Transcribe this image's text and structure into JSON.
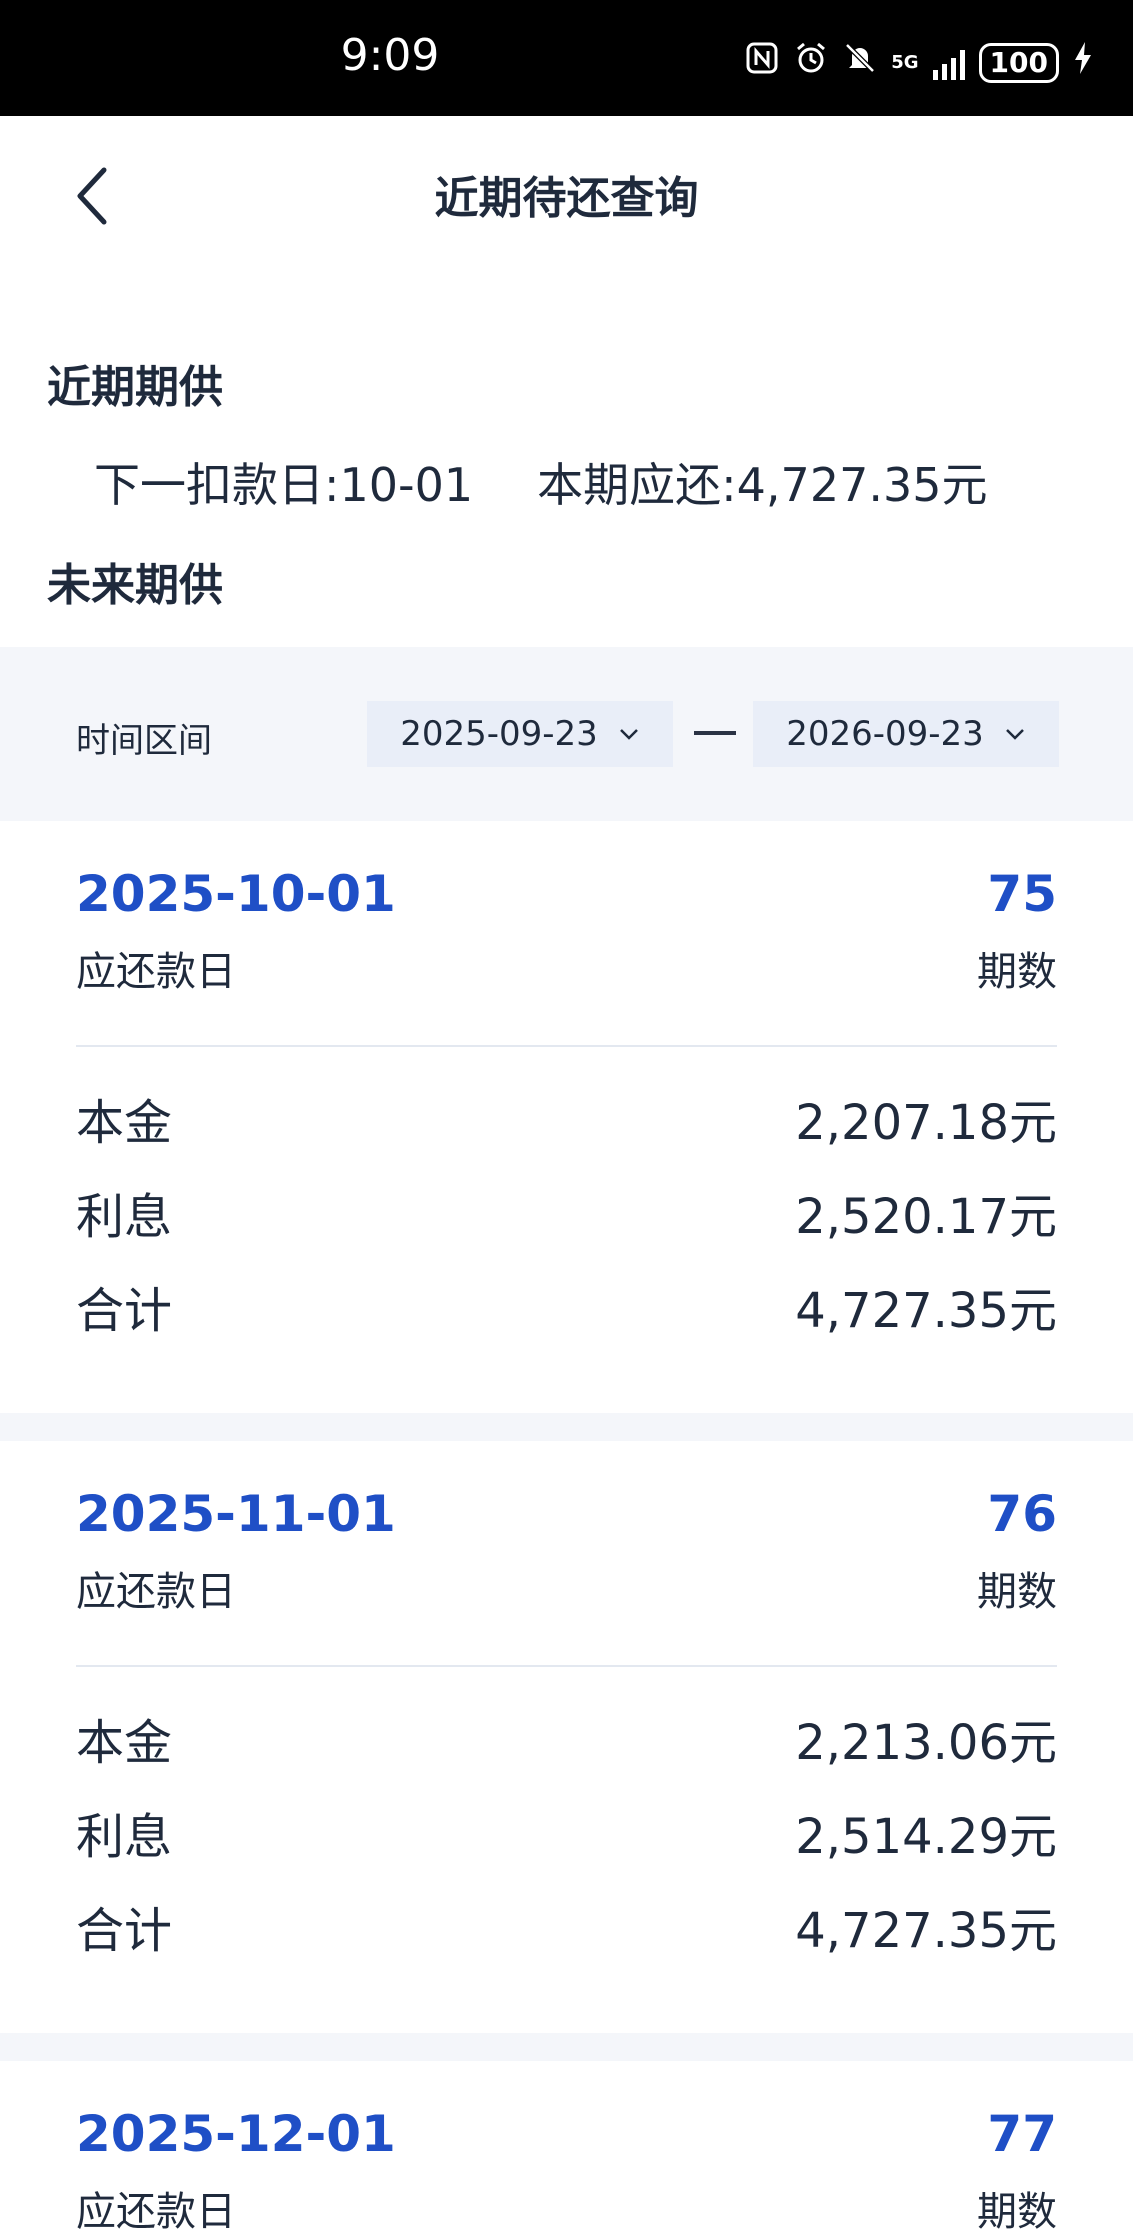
{
  "status_bar": {
    "time": "9:09",
    "battery": "100",
    "network": "5G",
    "icons": [
      "nfc-icon",
      "alarm-icon",
      "mute-icon",
      "signal-icon",
      "battery-icon",
      "charging-icon"
    ]
  },
  "header": {
    "title": "近期待还查询",
    "back_icon": "chevron-left-icon"
  },
  "recent": {
    "section_title": "近期期供",
    "next_deduction": "下一扣款日:10-01",
    "current_due": "本期应还:4,727.35元"
  },
  "future": {
    "section_title": "未来期供",
    "filter": {
      "label": "时间区间",
      "start_date": "2025-09-23",
      "end_date": "2026-09-23"
    }
  },
  "installments": [
    {
      "due_date": "2025-10-01",
      "due_date_label": "应还款日",
      "period": "75",
      "period_label": "期数",
      "rows": [
        {
          "label": "本金",
          "value": "2,207.18元"
        },
        {
          "label": "利息",
          "value": "2,520.17元"
        },
        {
          "label": "合计",
          "value": "4,727.35元"
        }
      ]
    },
    {
      "due_date": "2025-11-01",
      "due_date_label": "应还款日",
      "period": "76",
      "period_label": "期数",
      "rows": [
        {
          "label": "本金",
          "value": "2,213.06元"
        },
        {
          "label": "利息",
          "value": "2,514.29元"
        },
        {
          "label": "合计",
          "value": "4,727.35元"
        }
      ]
    },
    {
      "due_date": "2025-12-01",
      "due_date_label": "应还款日",
      "period": "77",
      "period_label": "期数",
      "rows": []
    }
  ],
  "colors": {
    "accent": "#1f4fc6",
    "text": "#1f2a3c",
    "panel": "#f4f6fa",
    "select_bg": "#e9eef8"
  }
}
